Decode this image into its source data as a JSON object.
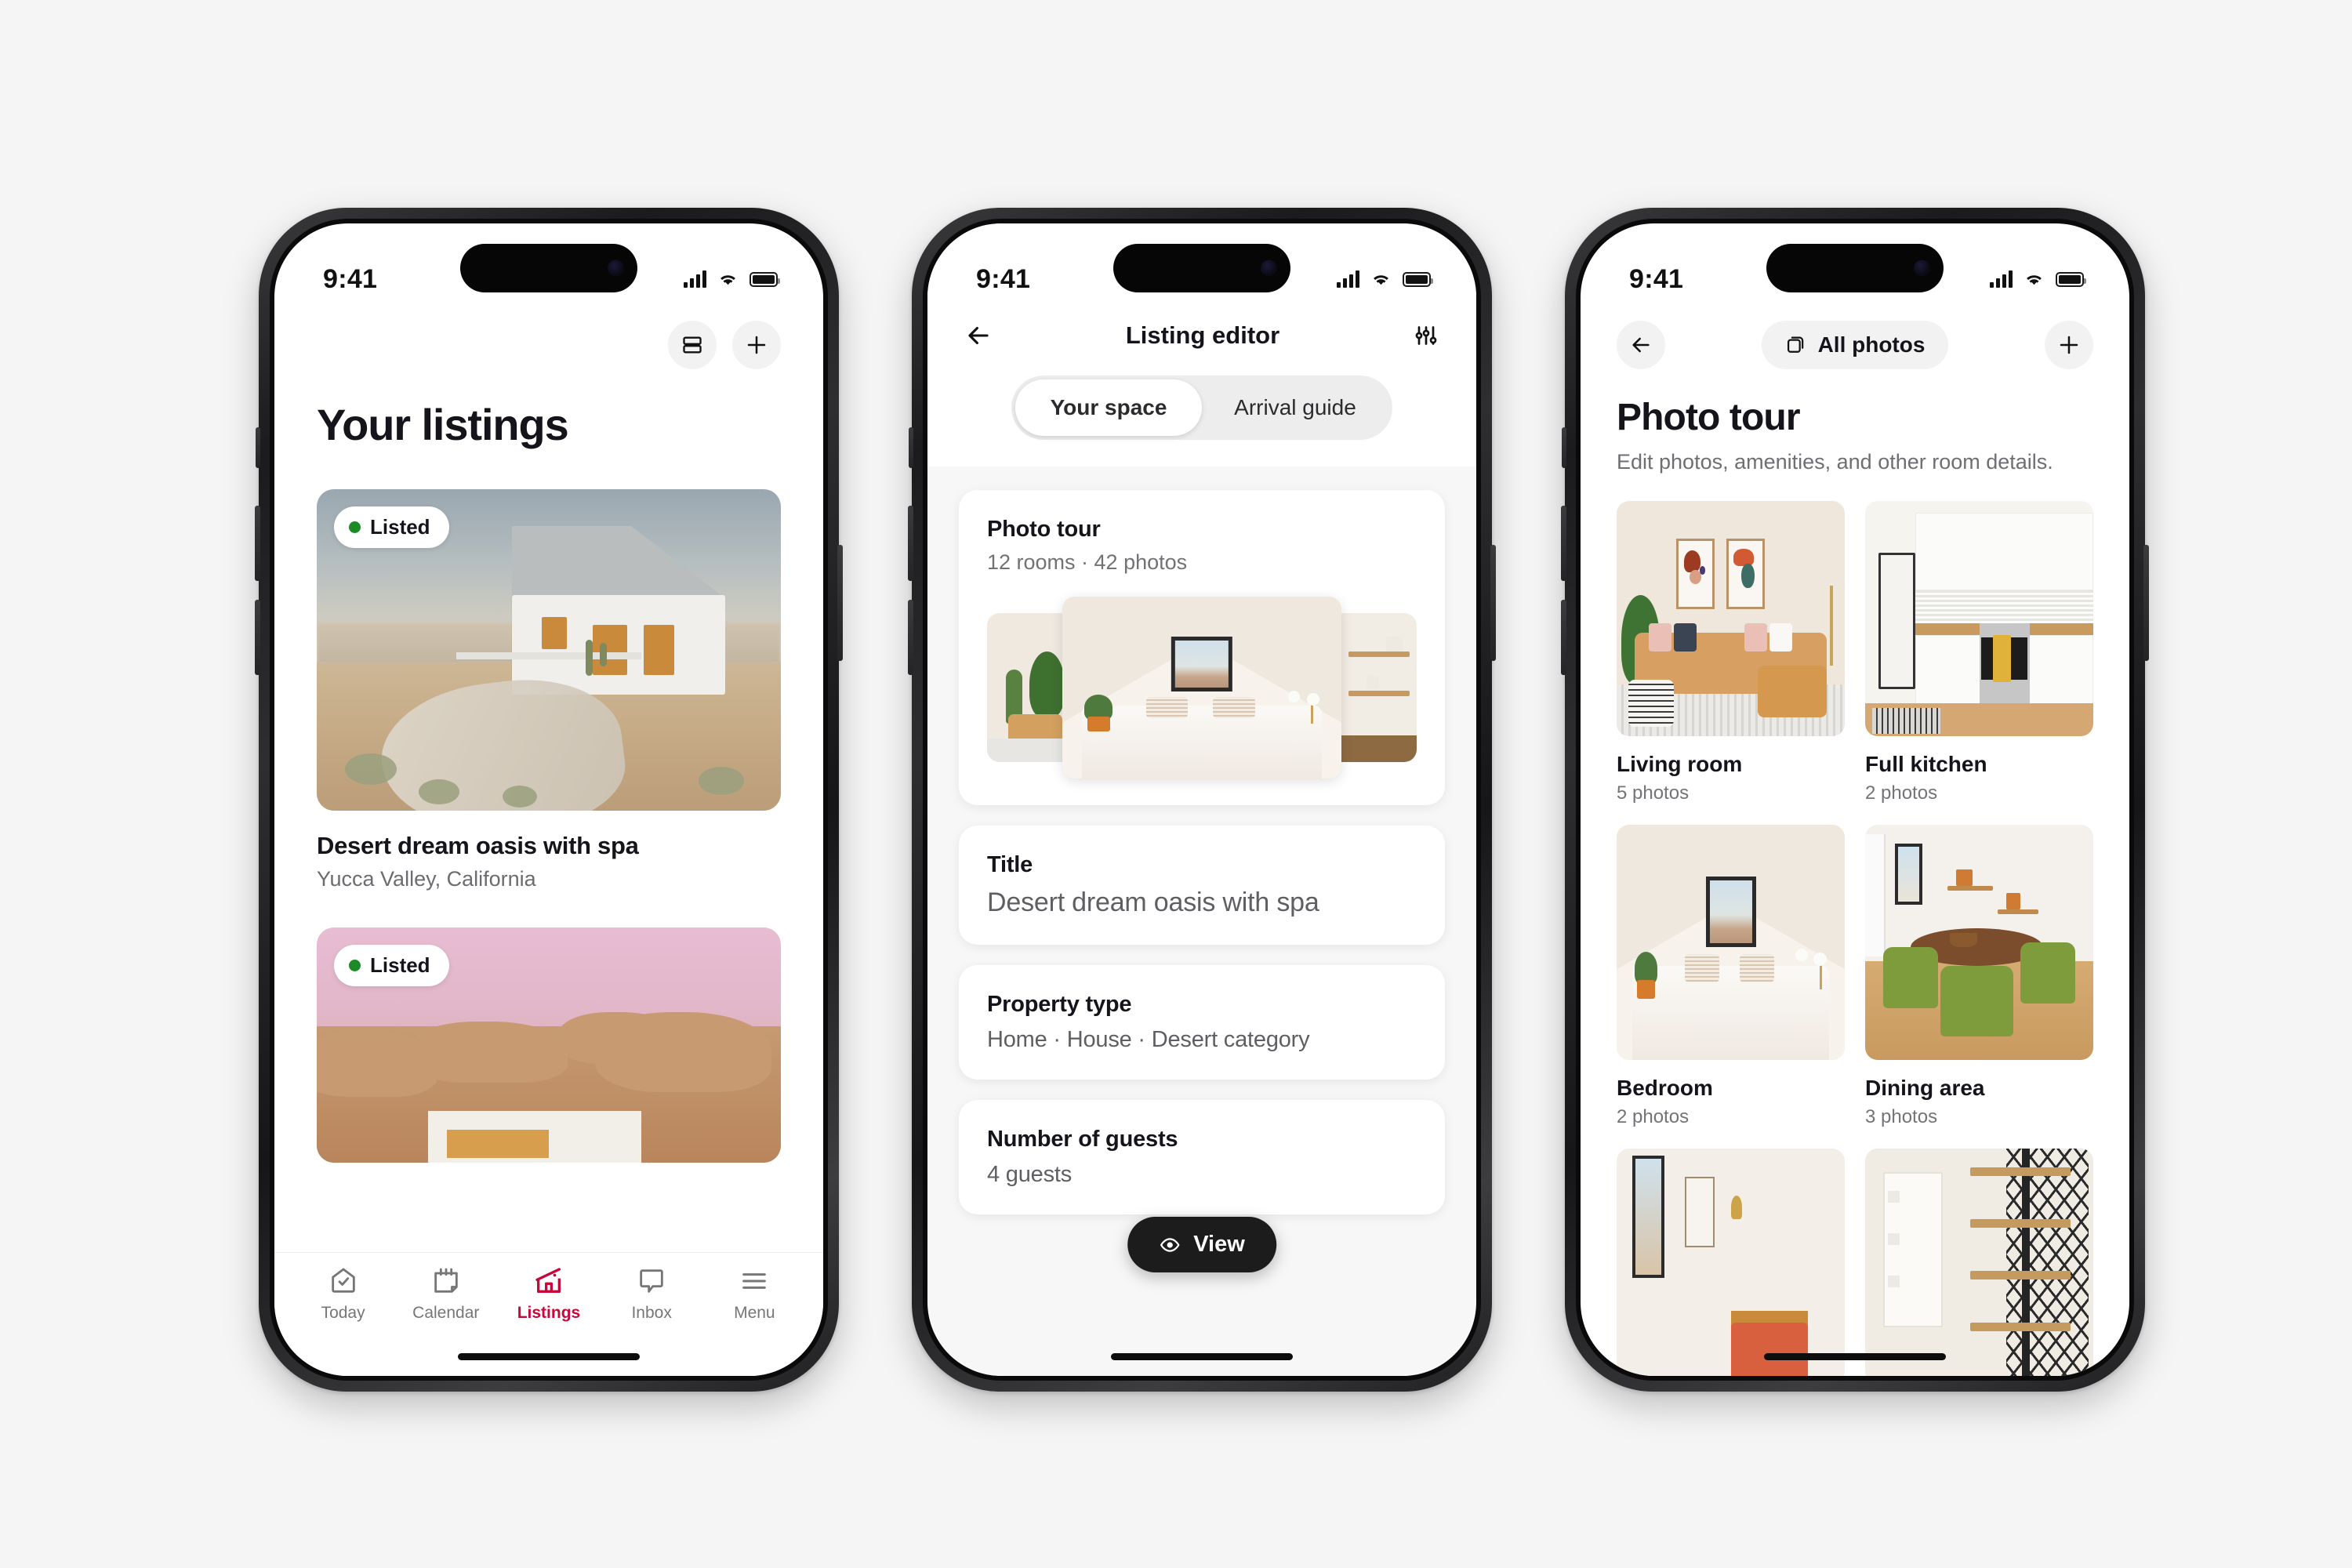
{
  "status_bar": {
    "time": "9:41",
    "signal_icon": "cellular-signal-icon",
    "wifi_icon": "wifi-icon",
    "battery_icon": "battery-icon"
  },
  "phone1": {
    "toolbar": {
      "view_toggle_icon": "layout-toggle-icon",
      "add_icon": "plus-icon"
    },
    "page_title": "Your listings",
    "listings": [
      {
        "status": "Listed",
        "name": "Desert dream oasis with spa",
        "location": "Yucca Valley, California"
      },
      {
        "status": "Listed",
        "name": "",
        "location": ""
      }
    ],
    "tabs": [
      {
        "label": "Today",
        "icon": "home-check-icon",
        "active": false
      },
      {
        "label": "Calendar",
        "icon": "calendar-icon",
        "active": false
      },
      {
        "label": "Listings",
        "icon": "listings-house-icon",
        "active": true
      },
      {
        "label": "Inbox",
        "icon": "chat-bubble-icon",
        "active": false
      },
      {
        "label": "Menu",
        "icon": "hamburger-menu-icon",
        "active": false
      }
    ],
    "accent_color": "#c4093b",
    "status_dot_color": "#1c8b26"
  },
  "phone2": {
    "nav": {
      "back_icon": "arrow-left-icon",
      "title": "Listing editor",
      "settings_icon": "sliders-icon"
    },
    "segmented": {
      "options": [
        "Your space",
        "Arrival guide"
      ],
      "selected": "Your space"
    },
    "cards": [
      {
        "heading": "Photo tour",
        "sub": "12 rooms · 42 photos"
      },
      {
        "heading": "Title",
        "value": "Desert dream oasis with spa"
      },
      {
        "heading": "Property type",
        "value": "Home · House · Desert category"
      },
      {
        "heading": "Number of guests",
        "value": "4 guests"
      }
    ],
    "view_button": {
      "label": "View",
      "icon": "eye-icon"
    }
  },
  "phone3": {
    "nav": {
      "back_icon": "arrow-left-icon",
      "all_photos_label": "All photos",
      "all_photos_icon": "stacked-photos-icon",
      "add_icon": "plus-icon"
    },
    "page_title": "Photo tour",
    "page_subtitle": "Edit photos, amenities, and other room details.",
    "rooms": [
      {
        "name": "Living room",
        "count": "5 photos"
      },
      {
        "name": "Full kitchen",
        "count": "2 photos"
      },
      {
        "name": "Bedroom",
        "count": "2 photos"
      },
      {
        "name": "Dining area",
        "count": "3 photos"
      },
      {
        "name": "",
        "count": ""
      },
      {
        "name": "",
        "count": ""
      }
    ]
  }
}
